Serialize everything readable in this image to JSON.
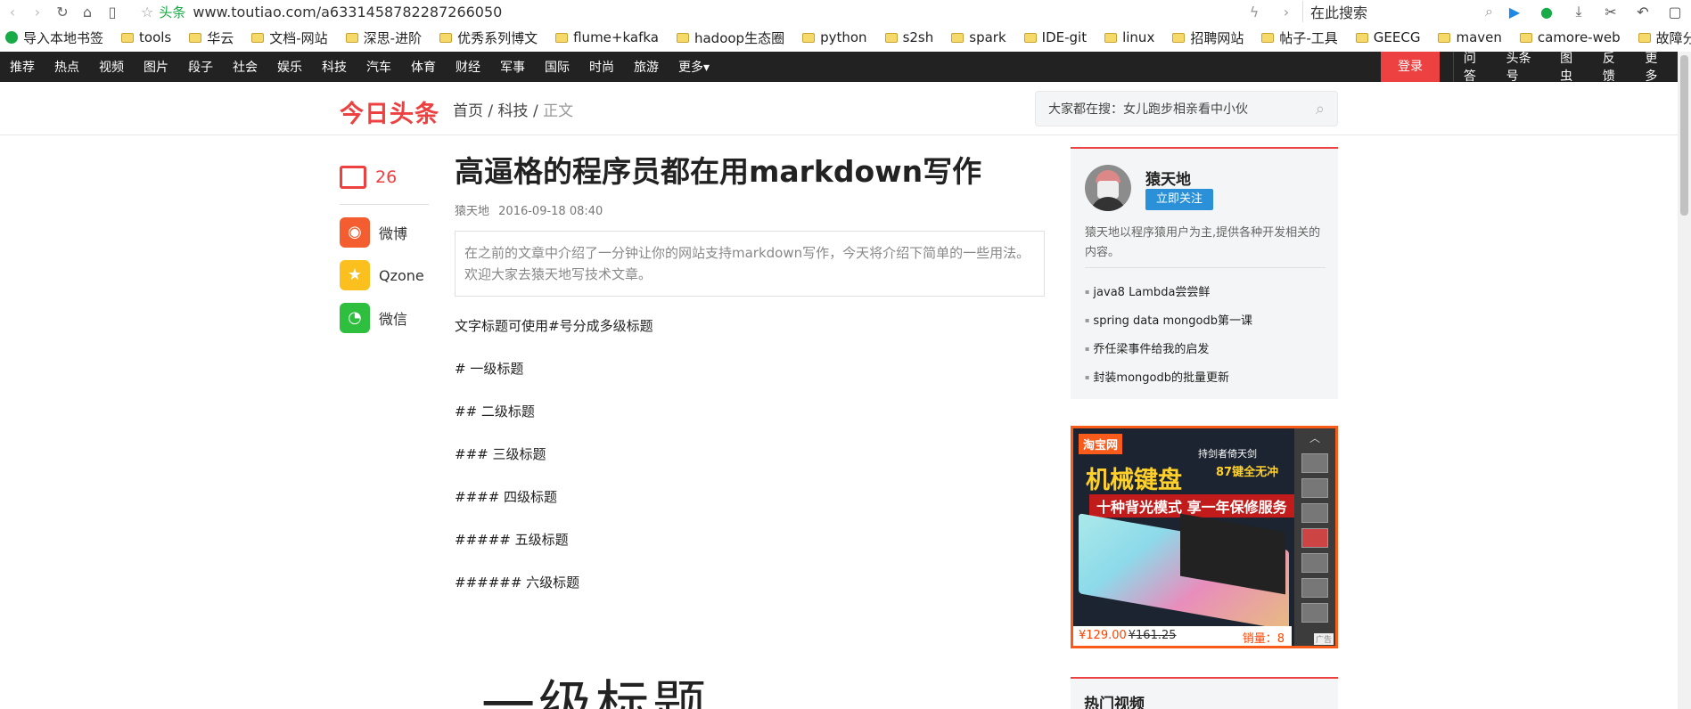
{
  "browser": {
    "badge": "头条",
    "url": "www.toutiao.com/a6331458782287266050",
    "search_placeholder": "在此搜索"
  },
  "bookmarks": [
    "导入本地书签",
    "tools",
    "华云",
    "文档-网站",
    "深思-进阶",
    "优秀系列博文",
    "flume+kafka",
    "hadoop生态圈",
    "python",
    "s2sh",
    "spark",
    "IDE-git",
    "linux",
    "招聘网站",
    "帖子-工具",
    "GEECG",
    "maven",
    "camore-web",
    "故障分析"
  ],
  "topnav": {
    "items": [
      "推荐",
      "热点",
      "视频",
      "图片",
      "段子",
      "社会",
      "娱乐",
      "科技",
      "汽车",
      "体育",
      "财经",
      "军事",
      "国际",
      "时尚",
      "旅游",
      "更多"
    ],
    "login": "登录",
    "right": [
      "问答",
      "头条号",
      "图虫",
      "反馈",
      "更多"
    ]
  },
  "header": {
    "logo": "今日头条",
    "crumb_home": "首页",
    "crumb_cat": "科技",
    "crumb_cur": "正文",
    "search_text": "大家都在搜：女儿跑步相亲看中小伙"
  },
  "share": {
    "comments": "26",
    "items": [
      "微博",
      "Qzone",
      "微信"
    ]
  },
  "article": {
    "title": "高逼格的程序员都在用markdown写作",
    "author": "猿天地",
    "time": "2016-09-18 08:40",
    "abstract_1": "在之前的文章中介绍了一分钟让你的网站支持markdown写作，今天将介绍下简单的一些用法。",
    "abstract_2": "欢迎大家去猿天地写技术文章。",
    "paragraphs": [
      "文字标题可使用#号分成多级标题",
      "# 一级标题",
      "## 二级标题",
      "### 三级标题",
      "#### 四级标题",
      "##### 五级标题",
      "###### 六级标题"
    ],
    "big_heading": "一级标题"
  },
  "sidebar": {
    "author_name": "猿天地",
    "follow": "立即关注",
    "desc": "猿天地以程序猿用户为主,提供各种开发相关的内容。",
    "links": [
      "java8 Lambda尝尝鲜",
      "spring data mongodb第一课",
      "乔任梁事件给我的启发",
      "封装mongodb的批量更新"
    ],
    "hot_title": "热门视频"
  },
  "ad": {
    "brand": "淘宝网",
    "slogan": "机械键盘",
    "sub1": "持剑者倚天剑",
    "sub2": "87键全无冲",
    "band": "十种背光模式 享一年保修服务",
    "price": "¥129.00",
    "old_price": "¥161.25",
    "sold": "销量：8",
    "tag": "广告"
  }
}
